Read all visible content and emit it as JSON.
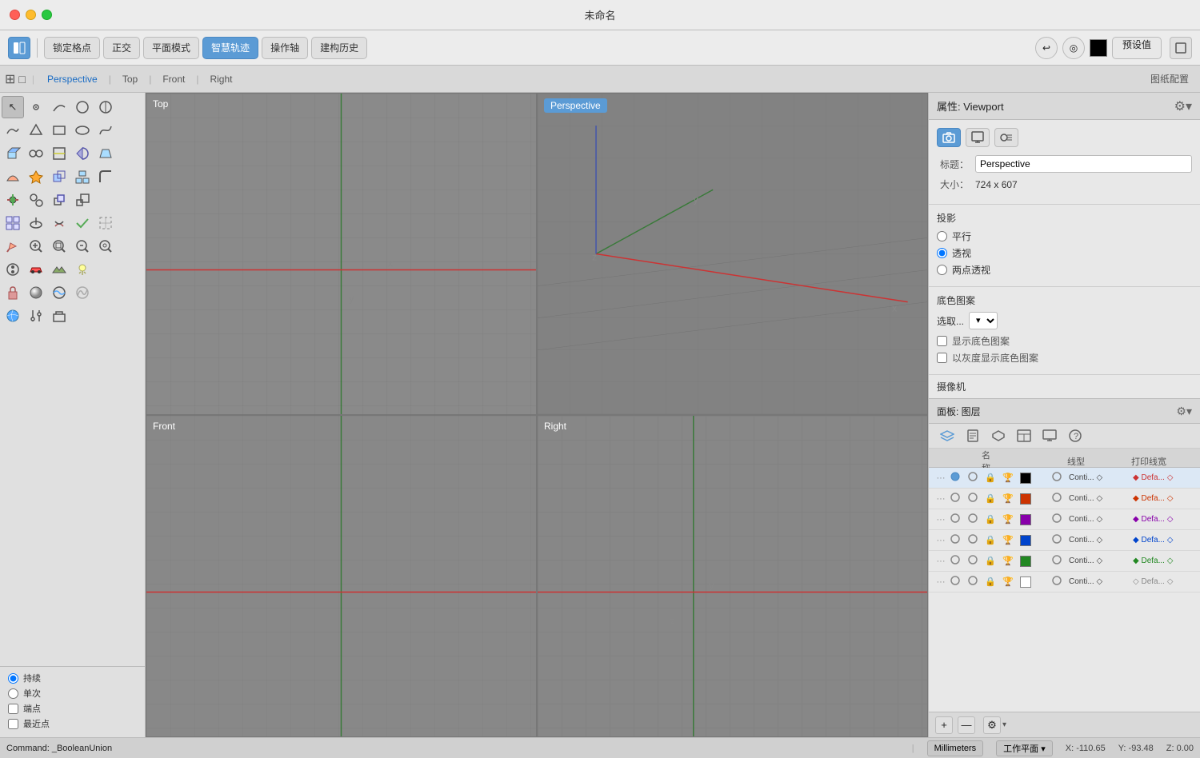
{
  "window": {
    "title": "未命名"
  },
  "toolbar": {
    "layout_left_label": "⬜",
    "lock_grid": "锁定格点",
    "orthographic": "正交",
    "plane_mode": "平面模式",
    "smart_track": "智慧轨迹",
    "operation_axis": "操作轴",
    "build_history": "建构历史",
    "preset": "预设值"
  },
  "view_tabs": {
    "grid_icon": "⊞",
    "perspective": "Perspective",
    "top": "Top",
    "front": "Front",
    "right": "Right",
    "drawing_settings": "图纸配置"
  },
  "viewports": {
    "top": {
      "label": "Top"
    },
    "perspective": {
      "label": "Perspective"
    },
    "front": {
      "label": "Front"
    },
    "right": {
      "label": "Right"
    }
  },
  "right_panel": {
    "title": "属性: Viewport",
    "settings_icon": "⚙",
    "viewport_title_label": "标题：",
    "viewport_title_value": "Perspective",
    "size_label": "大小：",
    "size_value": "724 x 607",
    "projection_title": "投影",
    "radio_parallel": "平行",
    "radio_perspective": "透视",
    "radio_two_point": "两点透视",
    "bg_image_title": "底色图案",
    "bg_select_label": "选取...",
    "bg_show_label": "显示底色图案",
    "bg_gray_label": "以灰度显示底色图案",
    "camera_title": "摄像机"
  },
  "layers_panel": {
    "title": "面板: 图层",
    "settings_icon": "⚙",
    "col_name": "名称",
    "col_linetype": "线型",
    "col_printwidth": "打印线宽",
    "plus_label": "+",
    "minus_label": "—",
    "rows": [
      {
        "active": true,
        "on": true,
        "locked": false,
        "color": "#000000",
        "linetype": "Conti...",
        "printwidth": "Defa..."
      },
      {
        "active": false,
        "on": true,
        "locked": false,
        "color": "#cc3300",
        "linetype": "Conti...",
        "printwidth": "Defa..."
      },
      {
        "active": false,
        "on": true,
        "locked": false,
        "color": "#8800aa",
        "linetype": "Conti...",
        "printwidth": "Defa..."
      },
      {
        "active": false,
        "on": true,
        "locked": false,
        "color": "#0044cc",
        "linetype": "Conti...",
        "printwidth": "Defa..."
      },
      {
        "active": false,
        "on": true,
        "locked": false,
        "color": "#228822",
        "linetype": "Conti...",
        "printwidth": "Defa..."
      },
      {
        "active": false,
        "on": true,
        "locked": false,
        "color": "#ffffff",
        "linetype": "Conti...",
        "printwidth": "Defa..."
      }
    ]
  },
  "status_bar": {
    "command": "Command: _BooleanUnion",
    "units": "Millimeters",
    "workplane": "工作平面",
    "x": "X: -110.65",
    "y": "Y: -93.48",
    "z": "Z: 0.00"
  },
  "snap_options": {
    "persistent_label": "持续",
    "single_label": "单次",
    "endpoint_label": "端点",
    "nearest_label": "最近点"
  },
  "tool_icons": [
    "↖",
    "⊙",
    "⬡",
    "◎",
    "⟲",
    "〜",
    "△",
    "⬭",
    "⬡",
    "⬲",
    "□",
    "◇",
    "⬡",
    "⬡",
    "⬭",
    "⊞",
    "⊟",
    "⟝",
    "☑",
    "◑",
    "🔧",
    "⊕",
    "⊖",
    "⊗",
    "⊘",
    "⊙",
    "◕",
    "🔎",
    "⊕",
    "◯"
  ]
}
